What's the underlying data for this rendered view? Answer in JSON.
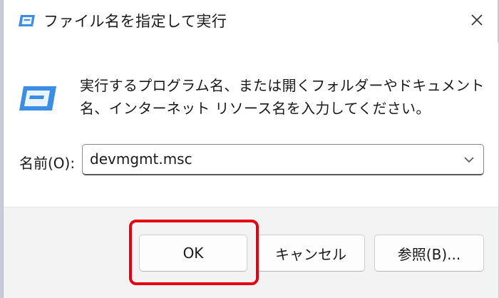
{
  "window": {
    "title": "ファイル名を指定して実行",
    "close_icon": "close-icon"
  },
  "content": {
    "description": "実行するプログラム名、または開くフォルダーやドキュメント名、インターネット リソース名を入力してください。",
    "name_label": "名前(O):",
    "name_value": "devmgmt.msc",
    "dropdown_icon": "chevron-down-icon"
  },
  "buttons": {
    "ok": "OK",
    "cancel": "キャンセル",
    "browse": "参照(B)..."
  },
  "colors": {
    "accent_icon": "#3a8ee6",
    "highlight": "#e60012",
    "footer_bg": "#f3f3f3"
  }
}
